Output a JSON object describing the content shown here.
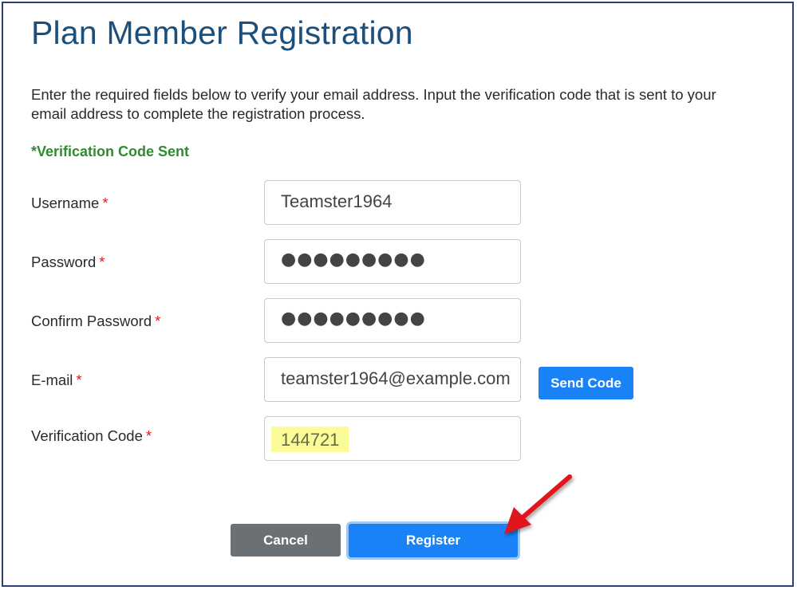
{
  "page": {
    "title": "Plan Member Registration",
    "intro": "Enter the required fields below to verify your email address. Input the verification code that is sent to your email address to complete the registration process.",
    "status_message": "*Verification Code Sent"
  },
  "form": {
    "required_mark": "*",
    "username": {
      "label": "Username",
      "value": "Teamster1964"
    },
    "password": {
      "label": "Password",
      "value": "●●●●●●●●●"
    },
    "confirm_password": {
      "label": "Confirm Password",
      "value": "●●●●●●●●●"
    },
    "email": {
      "label": "E-mail",
      "value": "teamster1964@example.com"
    },
    "verification_code": {
      "label": "Verification Code",
      "value": "144721"
    }
  },
  "buttons": {
    "send_code": "Send Code",
    "cancel": "Cancel",
    "register": "Register"
  },
  "colors": {
    "title": "#1d4f7c",
    "status": "#2e8b2e",
    "required": "#e02020",
    "primary": "#1a82f7",
    "secondary": "#6b7075",
    "highlight": "#fbfb9a",
    "annotation_arrow": "#e0141e"
  },
  "annotations": {
    "arrow_icon": "red-arrow-icon"
  }
}
